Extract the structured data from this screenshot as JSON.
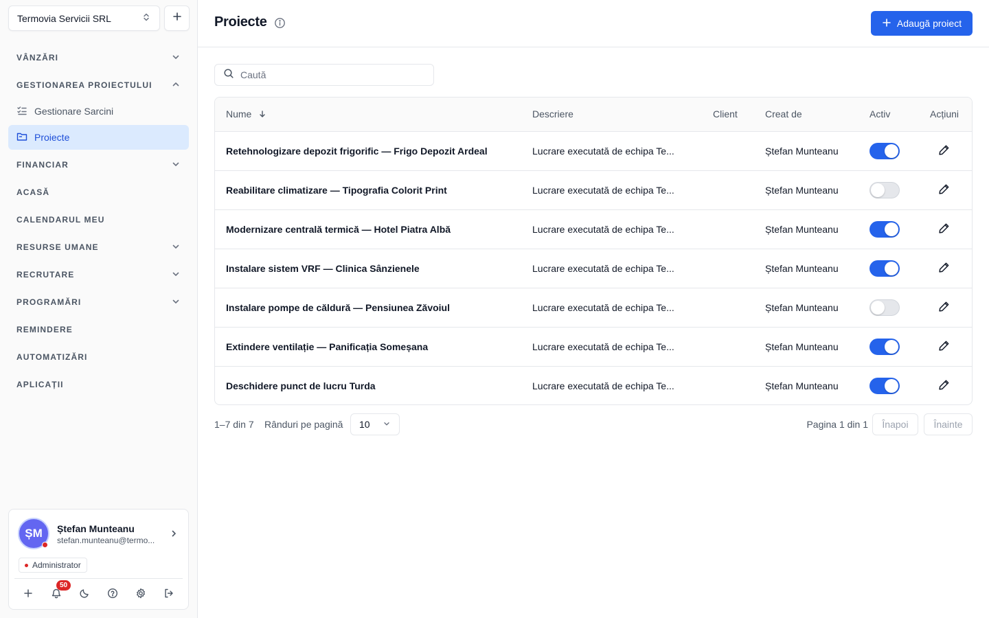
{
  "org": {
    "name": "Termovia Servicii SRL"
  },
  "sidebar": {
    "sections": [
      {
        "label": "VÂNZĂRI",
        "chevron": "down"
      },
      {
        "label": "GESTIONAREA PROIECTULUI",
        "chevron": "up"
      }
    ],
    "sub_items": [
      {
        "label": "Gestionare Sarcini",
        "icon": "task-list-icon",
        "active": false
      },
      {
        "label": "Proiecte",
        "icon": "folder-icon",
        "active": true
      }
    ],
    "sections_after": [
      {
        "label": "FINANCIAR",
        "chevron": "down"
      },
      {
        "label": "ACASĂ",
        "chevron": ""
      },
      {
        "label": "CALENDARUL MEU",
        "chevron": ""
      },
      {
        "label": "RESURSE UMANE",
        "chevron": "down"
      },
      {
        "label": "RECRUTARE",
        "chevron": "down"
      },
      {
        "label": "PROGRAMĂRI",
        "chevron": "down"
      },
      {
        "label": "REMINDERE",
        "chevron": ""
      },
      {
        "label": "AUTOMATIZĂRI",
        "chevron": ""
      },
      {
        "label": "APLICAȚII",
        "chevron": ""
      }
    ]
  },
  "user": {
    "initials": "ȘM",
    "name": "Ștefan Munteanu",
    "email": "stefan.munteanu@termo...",
    "role": "Administrator",
    "notifications": "50"
  },
  "header": {
    "title": "Proiecte",
    "add_label": "Adaugă proiect"
  },
  "search": {
    "placeholder": "Caută"
  },
  "table": {
    "columns": {
      "name": "Nume",
      "description": "Descriere",
      "client": "Client",
      "created_by": "Creat de",
      "active": "Activ",
      "actions": "Acțiuni"
    },
    "rows": [
      {
        "name": "Retehnologizare depozit frigorific — Frigo Depozit Ardeal",
        "description": "Lucrare executată de echipa Te...",
        "client": "",
        "created_by": "Ștefan Munteanu",
        "active": true
      },
      {
        "name": "Reabilitare climatizare — Tipografia Colorit Print",
        "description": "Lucrare executată de echipa Te...",
        "client": "",
        "created_by": "Ștefan Munteanu",
        "active": false
      },
      {
        "name": "Modernizare centrală termică — Hotel Piatra Albă",
        "description": "Lucrare executată de echipa Te...",
        "client": "",
        "created_by": "Ștefan Munteanu",
        "active": true
      },
      {
        "name": "Instalare sistem VRF — Clinica Sânzienele",
        "description": "Lucrare executată de echipa Te...",
        "client": "",
        "created_by": "Ștefan Munteanu",
        "active": true
      },
      {
        "name": "Instalare pompe de căldură — Pensiunea Zăvoiul",
        "description": "Lucrare executată de echipa Te...",
        "client": "",
        "created_by": "Ștefan Munteanu",
        "active": false
      },
      {
        "name": "Extindere ventilație — Panificația Someșana",
        "description": "Lucrare executată de echipa Te...",
        "client": "",
        "created_by": "Ștefan Munteanu",
        "active": true
      },
      {
        "name": "Deschidere punct de lucru Turda",
        "description": "Lucrare executată de echipa Te...",
        "client": "",
        "created_by": "Ștefan Munteanu",
        "active": true
      }
    ]
  },
  "pagination": {
    "range": "1–7 din 7",
    "rows_label": "Rânduri pe pagină",
    "rows_value": "10",
    "page_info": "Pagina 1 din 1",
    "prev": "Înapoi",
    "next": "Înainte"
  },
  "colors": {
    "accent": "#2563eb",
    "active_nav_bg": "#dbeafe",
    "avatar": "#6366f1",
    "alert": "#dc2626"
  }
}
